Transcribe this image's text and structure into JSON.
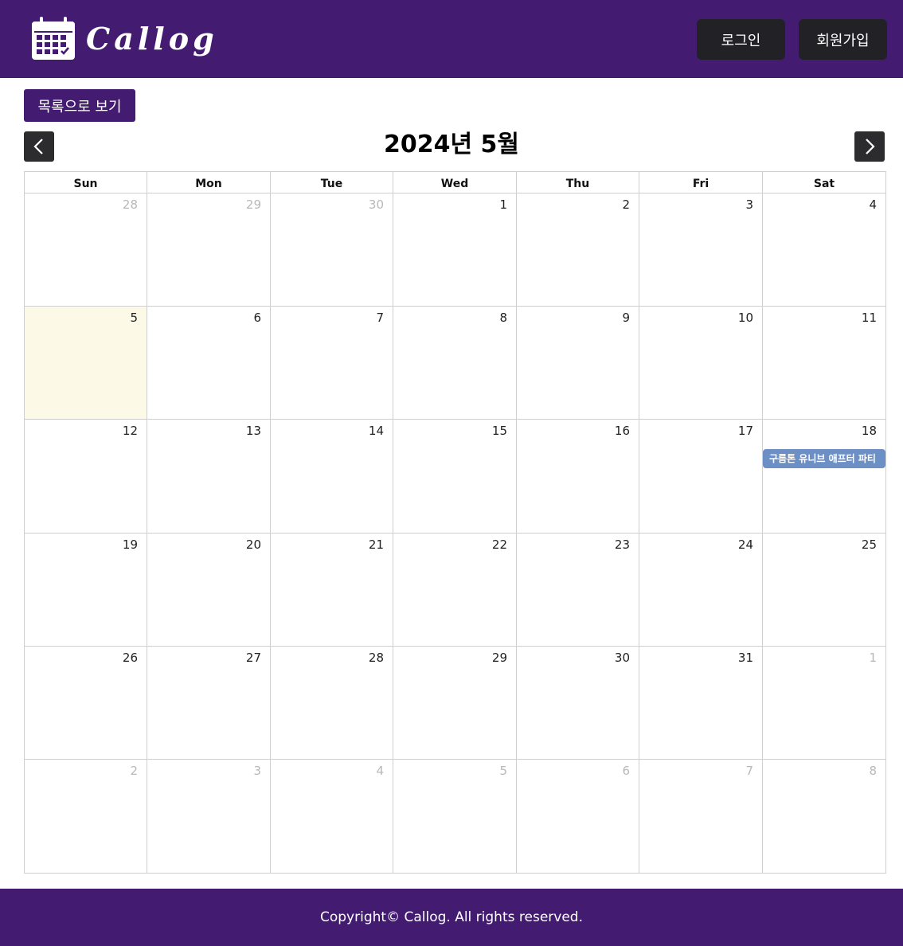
{
  "header": {
    "logo_text": "Callog",
    "login_label": "로그인",
    "signup_label": "회원가입"
  },
  "toolbar": {
    "list_view_label": "목록으로 보기",
    "month_title": "2024년 5월"
  },
  "calendar": {
    "weekdays": [
      "Sun",
      "Mon",
      "Tue",
      "Wed",
      "Thu",
      "Fri",
      "Sat"
    ],
    "weeks": [
      [
        {
          "d": "28",
          "other": true
        },
        {
          "d": "29",
          "other": true
        },
        {
          "d": "30",
          "other": true
        },
        {
          "d": "1"
        },
        {
          "d": "2"
        },
        {
          "d": "3"
        },
        {
          "d": "4"
        }
      ],
      [
        {
          "d": "5",
          "today": true
        },
        {
          "d": "6"
        },
        {
          "d": "7"
        },
        {
          "d": "8"
        },
        {
          "d": "9"
        },
        {
          "d": "10"
        },
        {
          "d": "11"
        }
      ],
      [
        {
          "d": "12"
        },
        {
          "d": "13"
        },
        {
          "d": "14"
        },
        {
          "d": "15"
        },
        {
          "d": "16"
        },
        {
          "d": "17"
        },
        {
          "d": "18",
          "event": "구름톤 유니브 애프터 파티"
        }
      ],
      [
        {
          "d": "19"
        },
        {
          "d": "20"
        },
        {
          "d": "21"
        },
        {
          "d": "22"
        },
        {
          "d": "23"
        },
        {
          "d": "24"
        },
        {
          "d": "25"
        }
      ],
      [
        {
          "d": "26"
        },
        {
          "d": "27"
        },
        {
          "d": "28"
        },
        {
          "d": "29"
        },
        {
          "d": "30"
        },
        {
          "d": "31"
        },
        {
          "d": "1",
          "other": true
        }
      ],
      [
        {
          "d": "2",
          "other": true
        },
        {
          "d": "3",
          "other": true
        },
        {
          "d": "4",
          "other": true
        },
        {
          "d": "5",
          "other": true
        },
        {
          "d": "6",
          "other": true
        },
        {
          "d": "7",
          "other": true
        },
        {
          "d": "8",
          "other": true
        }
      ]
    ]
  },
  "footer": {
    "copyright": "Copyright© Callog. All rights reserved."
  },
  "colors": {
    "brand": "#431c71",
    "button_dark": "#222126",
    "today_bg": "#fcf9e7",
    "event_bg": "#6c8fc5"
  }
}
